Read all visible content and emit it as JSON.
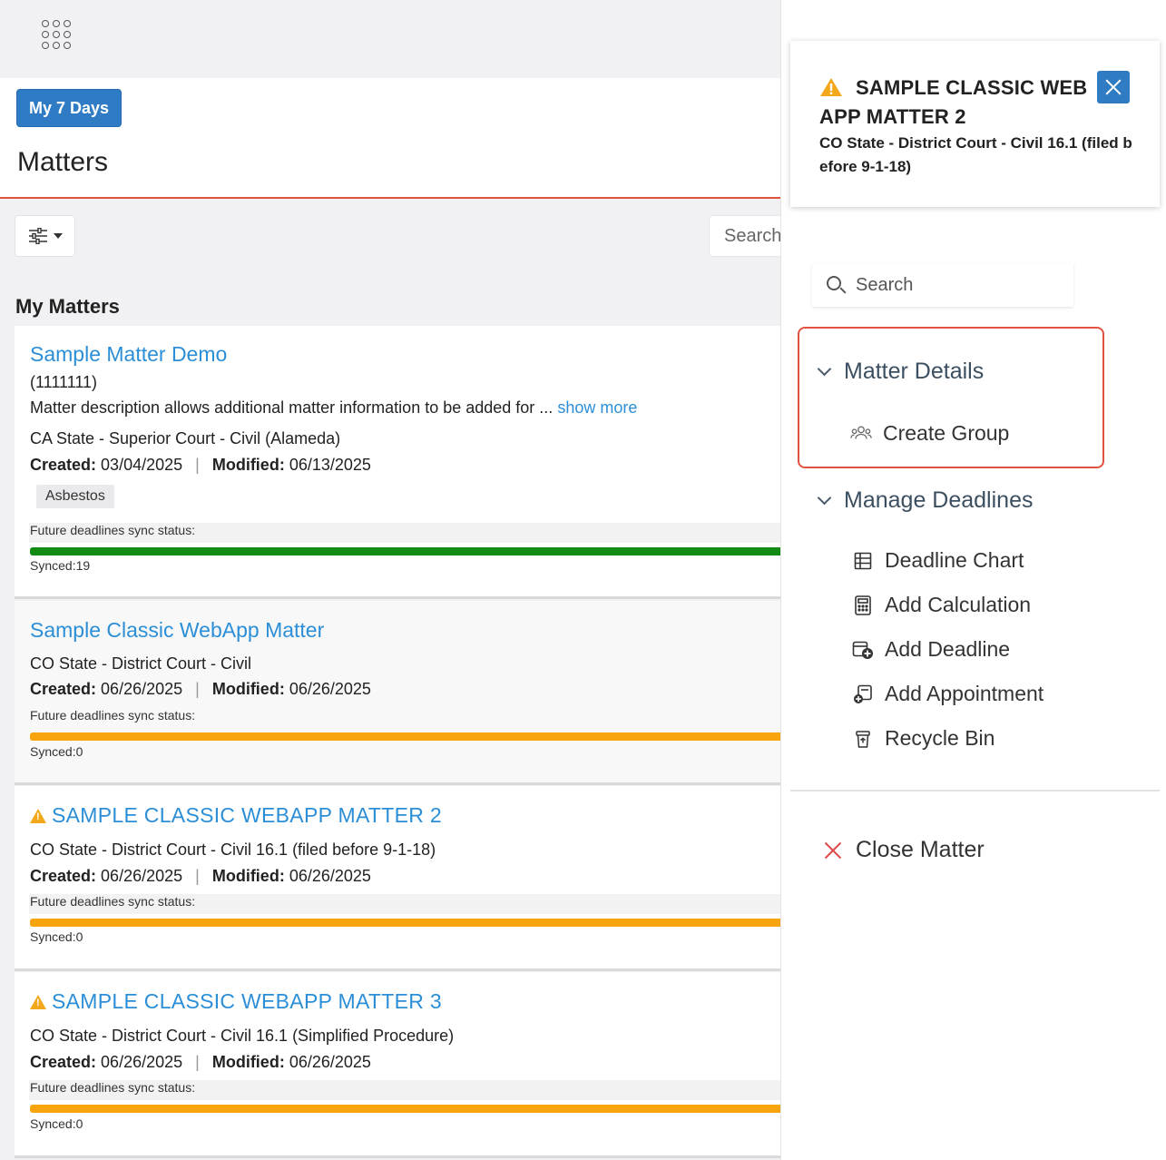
{
  "header": {
    "my7_label": "My 7 Days",
    "page_title": "Matters",
    "search_placeholder": "Search"
  },
  "section_title": "My Matters",
  "matters": [
    {
      "title": "Sample Matter Demo",
      "number": "(1111111)",
      "description": "Matter description allows additional matter information to be added for ...",
      "show_more": "show more",
      "court": "CA State - Superior Court - Civil (Alameda)",
      "created_label": "Created:",
      "created": "03/04/2025",
      "modified_label": "Modified:",
      "modified": "06/13/2025",
      "tag": "Asbestos",
      "sync_label": "Future deadlines sync status:",
      "synced": "Synced:19",
      "sync_color": "#138a13",
      "warning": false
    },
    {
      "title": "Sample Classic WebApp Matter",
      "court": "CO State - District Court - Civil",
      "created_label": "Created:",
      "created": "06/26/2025",
      "modified_label": "Modified:",
      "modified": "06/26/2025",
      "sync_label": "Future deadlines sync status:",
      "synced": "Synced:0",
      "sync_color": "#f7a40d",
      "warning": false
    },
    {
      "title": "SAMPLE CLASSIC WEBAPP MATTER 2",
      "court": "CO State - District Court - Civil 16.1 (filed before 9-1-18)",
      "created_label": "Created:",
      "created": "06/26/2025",
      "modified_label": "Modified:",
      "modified": "06/26/2025",
      "sync_label": "Future deadlines sync status:",
      "synced": "Synced:0",
      "sync_color": "#f7a40d",
      "warning": true
    },
    {
      "title": "SAMPLE CLASSIC WEBAPP MATTER 3",
      "court": "CO State - District Court - Civil 16.1 (Simplified Procedure)",
      "created_label": "Created:",
      "created": "06/26/2025",
      "modified_label": "Modified:",
      "modified": "06/26/2025",
      "sync_label": "Future deadlines sync status:",
      "synced": "Synced:0",
      "sync_color": "#f7a40d",
      "warning": true
    }
  ],
  "panel": {
    "matter_title": "SAMPLE CLASSIC WEB APP MATTER 2",
    "matter_court": "CO State - District Court - Civil 16.1 (filed before 9-1-18)",
    "search_placeholder": "Search",
    "groups": [
      {
        "label": "Matter Details",
        "items": [
          {
            "label": "Create Group",
            "icon": "group-icon"
          }
        ]
      },
      {
        "label": "Manage Deadlines",
        "items": [
          {
            "label": "Deadline Chart",
            "icon": "table-chart-icon"
          },
          {
            "label": "Add Calculation",
            "icon": "calculator-icon"
          },
          {
            "label": "Add Deadline",
            "icon": "add-deadline-icon"
          },
          {
            "label": "Add Appointment",
            "icon": "add-appointment-icon"
          },
          {
            "label": "Recycle Bin",
            "icon": "recycle-bin-icon"
          }
        ]
      }
    ],
    "close_label": "Close Matter"
  },
  "colors": {
    "accent_blue": "#2f7bc4",
    "link_blue": "#2b8ed6",
    "highlight_red": "#e2533f",
    "warning_orange": "#f3a81c"
  }
}
